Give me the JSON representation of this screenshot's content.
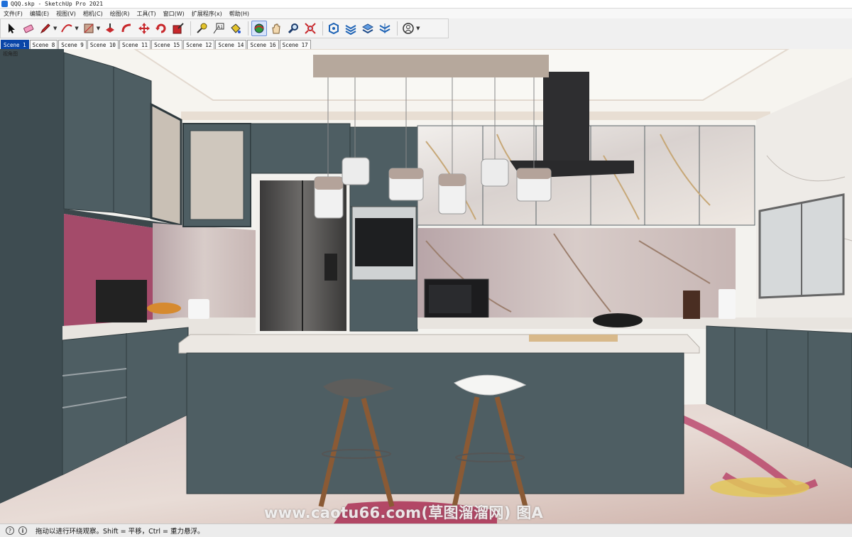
{
  "window": {
    "title": "QQQ.skp - SketchUp Pro 2021"
  },
  "menu": [
    "文件(F)",
    "编辑(E)",
    "视图(V)",
    "相机(C)",
    "绘图(R)",
    "工具(T)",
    "窗口(W)",
    "扩展程序(x)",
    "帮助(H)"
  ],
  "toolbar": {
    "tools": [
      "select-tool",
      "eraser-tool",
      "line-tool",
      "arc-tool",
      "shape-tool",
      "push-pull-tool",
      "follow-me-tool",
      "move-tool",
      "rotate-tool",
      "scale-tool",
      "tape-measure-tool",
      "text-tool",
      "paint-bucket-tool",
      "orbit-tool",
      "pan-tool",
      "zoom-tool",
      "zoom-extents-tool",
      "components-tool",
      "materials-tool",
      "layers-tool",
      "styles-tool",
      "user-account"
    ]
  },
  "scenes": {
    "tabs": [
      "Scene 1",
      "Scene 8",
      "Scene 9",
      "Scene 10",
      "Scene 11",
      "Scene 15",
      "Scene 12",
      "Scene 14",
      "Scene 16",
      "Scene 17"
    ],
    "active_index": 0
  },
  "viewport": {
    "label": "视角图",
    "watermark": "www.caotu66.com(草图溜溜网) 图A"
  },
  "colors": {
    "accent": "#0a46a8",
    "cabinet": "#4e5e63",
    "cabinet_dark": "#3f4d52",
    "marble": "#ece8e4",
    "ceiling": "#f7f5f0"
  },
  "status": {
    "text": "拖动以进行环绕观察。Shift = 平移，Ctrl = 重力悬浮。"
  }
}
